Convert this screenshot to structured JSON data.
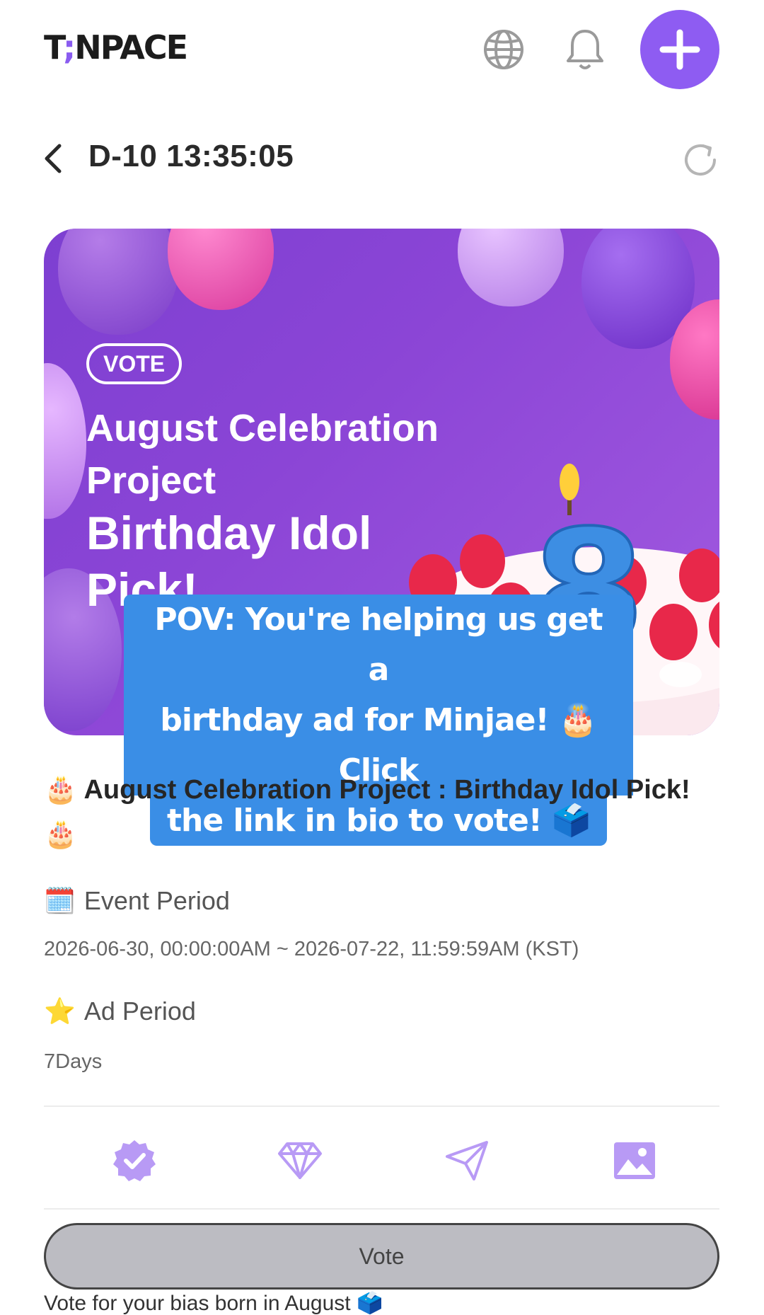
{
  "header": {
    "logo_text_a": "T",
    "logo_text_b": ";",
    "logo_text_c": "NPACE",
    "icons": [
      "globe-icon",
      "bell-icon",
      "plus-icon"
    ],
    "accent_color": "#8e5cf2"
  },
  "countdown": {
    "text": "D-10 13:35:05"
  },
  "banner": {
    "badge": "VOTE",
    "title_line1": "August Celebration Project",
    "title_line2": "Birthday Idol Pick!",
    "candle_number": "8"
  },
  "caption": {
    "line1": "POV: You're helping us get a",
    "line2": "birthday ad for Minjae! 🎂 Click",
    "line3": "the link in bio to vote! 🗳️",
    "color": "#3a8ee6"
  },
  "post": {
    "title": "🎂 August Celebration Project : Birthday Idol Pick! 🎂",
    "event_period_label": "Event Period",
    "event_period_emoji": "🗓️",
    "event_period_value": "2026-06-30, 00:00:00AM ~ 2026-07-22, 11:59:59AM (KST)",
    "ad_period_label": "Ad Period",
    "ad_period_emoji": "⭐",
    "ad_period_value": "7Days"
  },
  "actions": {
    "icons": [
      "verified-badge-icon",
      "diamond-icon",
      "send-icon",
      "image-icon"
    ]
  },
  "vote_button": {
    "label": "Vote"
  },
  "footer": {
    "text": "Vote for your bias born in August 🗳️"
  }
}
